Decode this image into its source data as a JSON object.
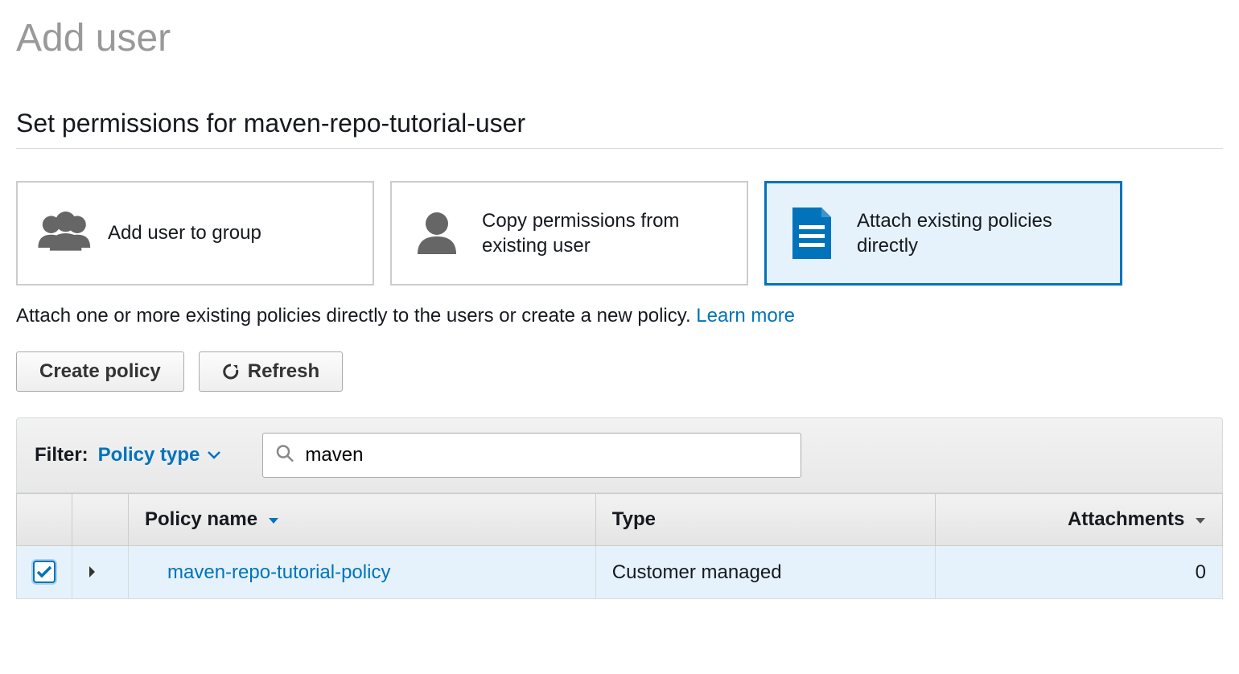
{
  "page": {
    "title": "Add user"
  },
  "section": {
    "title": "Set permissions for maven-repo-tutorial-user"
  },
  "options": [
    {
      "label": "Add user to group"
    },
    {
      "label": "Copy permissions from existing user"
    },
    {
      "label": "Attach existing policies directly"
    }
  ],
  "help": {
    "text": "Attach one or more existing policies directly to the users or create a new policy. ",
    "link": "Learn more"
  },
  "actions": {
    "create_policy": "Create policy",
    "refresh": "Refresh"
  },
  "filter": {
    "label": "Filter:",
    "dropdown": "Policy type",
    "search_value": "maven"
  },
  "table": {
    "headers": {
      "policy_name": "Policy name",
      "type": "Type",
      "attachments": "Attachments"
    },
    "rows": [
      {
        "checked": true,
        "name": "maven-repo-tutorial-policy",
        "type": "Customer managed",
        "attachments": "0"
      }
    ]
  }
}
